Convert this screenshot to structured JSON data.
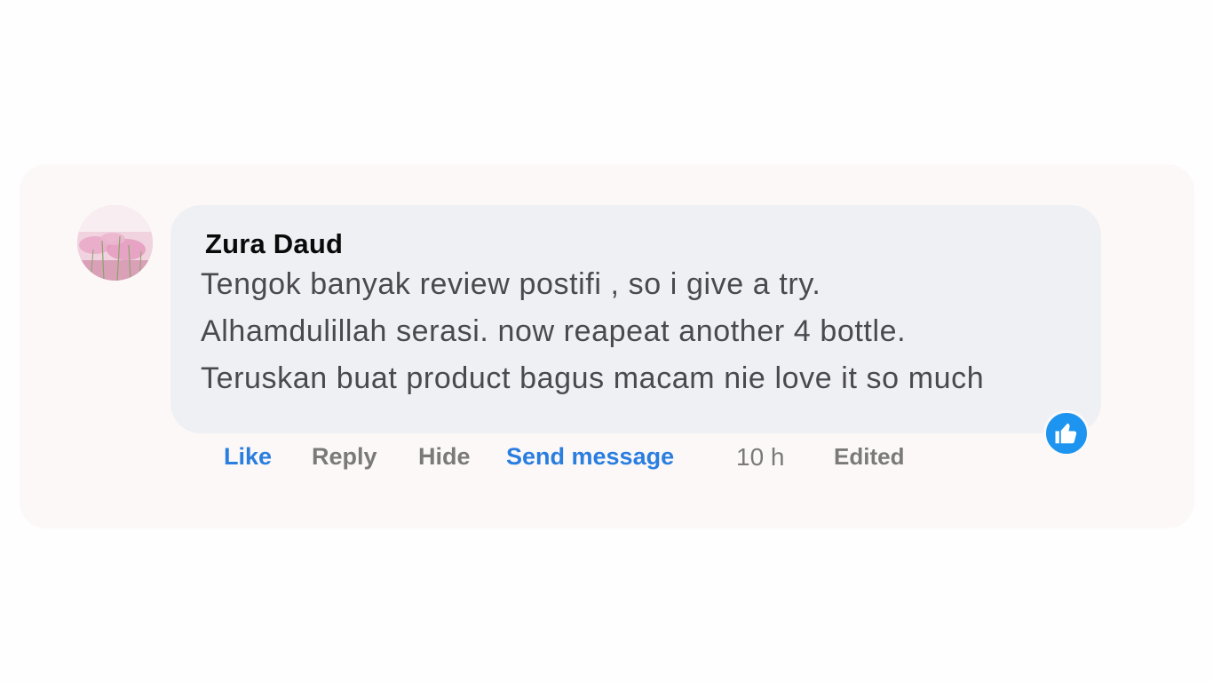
{
  "comment": {
    "author": "Zura Daud",
    "lines": [
      "Tengok banyak review postifi , so i give a try.",
      "Alhamdulillah serasi. now reapeat another 4 bottle.",
      "Teruskan buat product bagus macam nie love it so much"
    ],
    "reaction_icon": "thumbs-up-icon",
    "avatar_icon": "avatar-pink-flowers"
  },
  "actions": {
    "like": "Like",
    "reply": "Reply",
    "hide": "Hide",
    "send_message": "Send message"
  },
  "meta": {
    "time": "10 h",
    "edited": "Edited"
  },
  "colors": {
    "accent_blue": "#2a7ee0",
    "reaction_blue": "#1d95f0",
    "bubble_bg": "#eff0f4",
    "card_bg": "#fcf8f7"
  }
}
